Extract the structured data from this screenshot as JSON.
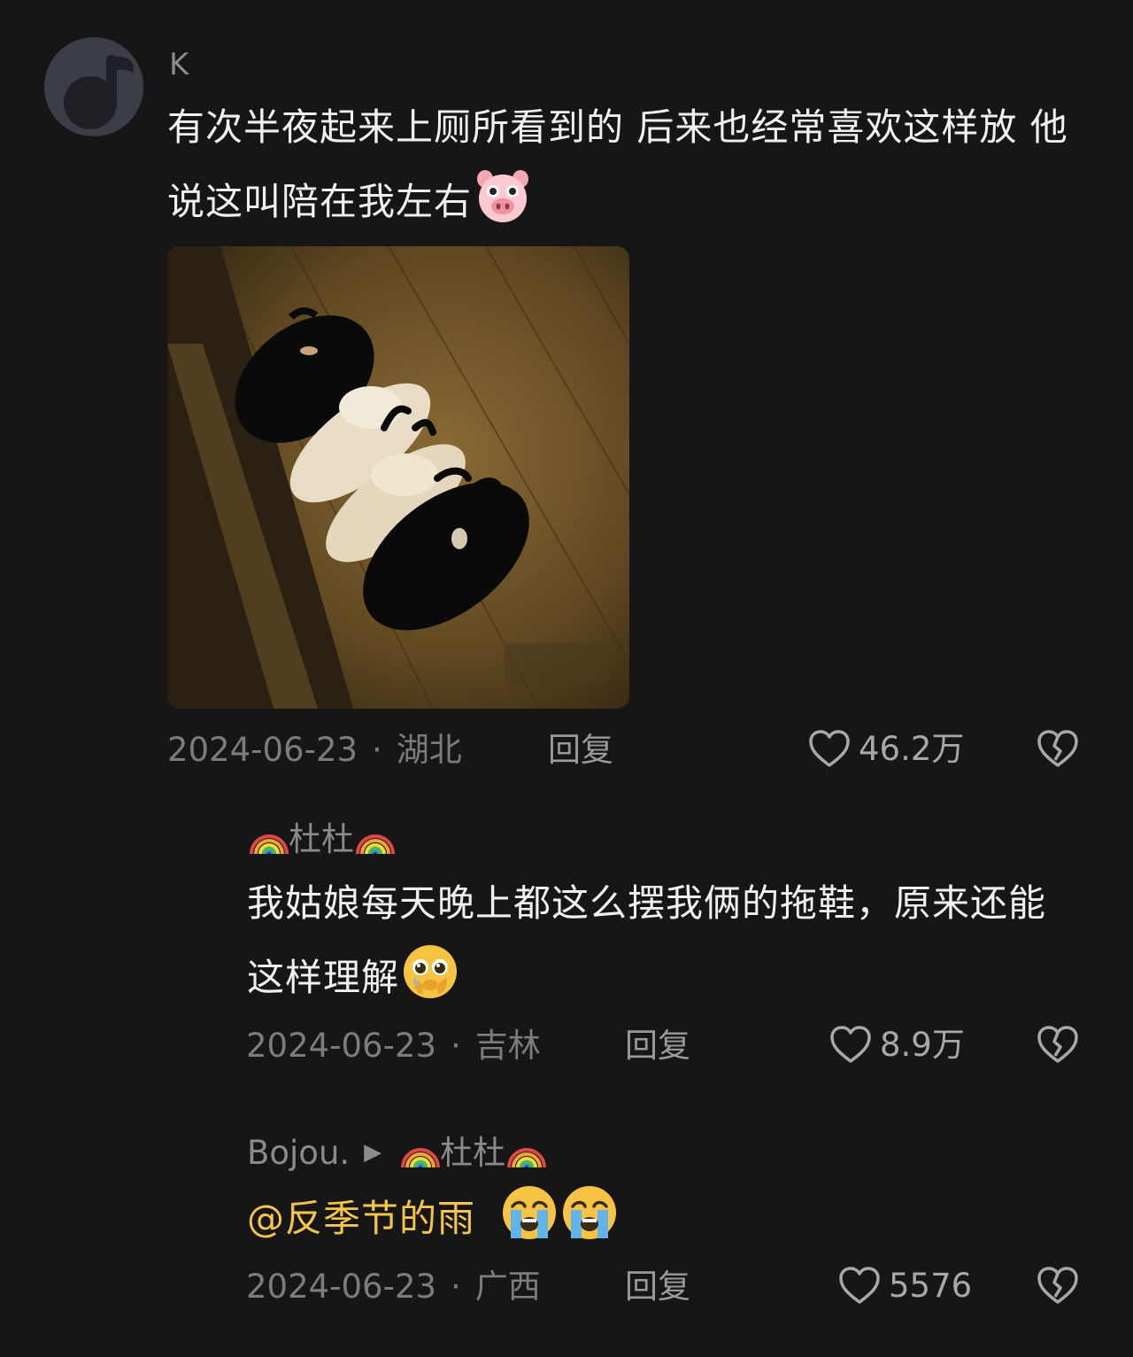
{
  "colors": {
    "background": "#161616",
    "text_primary": "#f0f0f0",
    "text_muted": "#7c7c7c",
    "mention": "#f3c548"
  },
  "comment_main": {
    "username": "K",
    "text": "有次半夜起来上厕所看到的 后来也经常喜欢这样放 他说这叫陪在我左右",
    "emoji": "pig-face-emoji",
    "image": "slippers-photo",
    "date": "2024-06-23",
    "separator": "·",
    "location": "湖北",
    "reply_label": "回复",
    "likes": "46.2万"
  },
  "reply_1": {
    "username": "杜杜",
    "text": "我姑娘每天晚上都这么摆我俩的拖鞋，原来还能这样理解",
    "emoji": "pleading-face-emoji",
    "date": "2024-06-23",
    "separator": "·",
    "location": "吉林",
    "reply_label": "回复",
    "likes": "8.9万"
  },
  "reply_2": {
    "username": "Bojou.",
    "arrow": "▶",
    "reply_to": "杜杜",
    "mention": "@反季节的雨",
    "emoji": "crying-face-emoji",
    "date": "2024-06-23",
    "separator": "·",
    "location": "广西",
    "reply_label": "回复",
    "likes": "5576"
  }
}
